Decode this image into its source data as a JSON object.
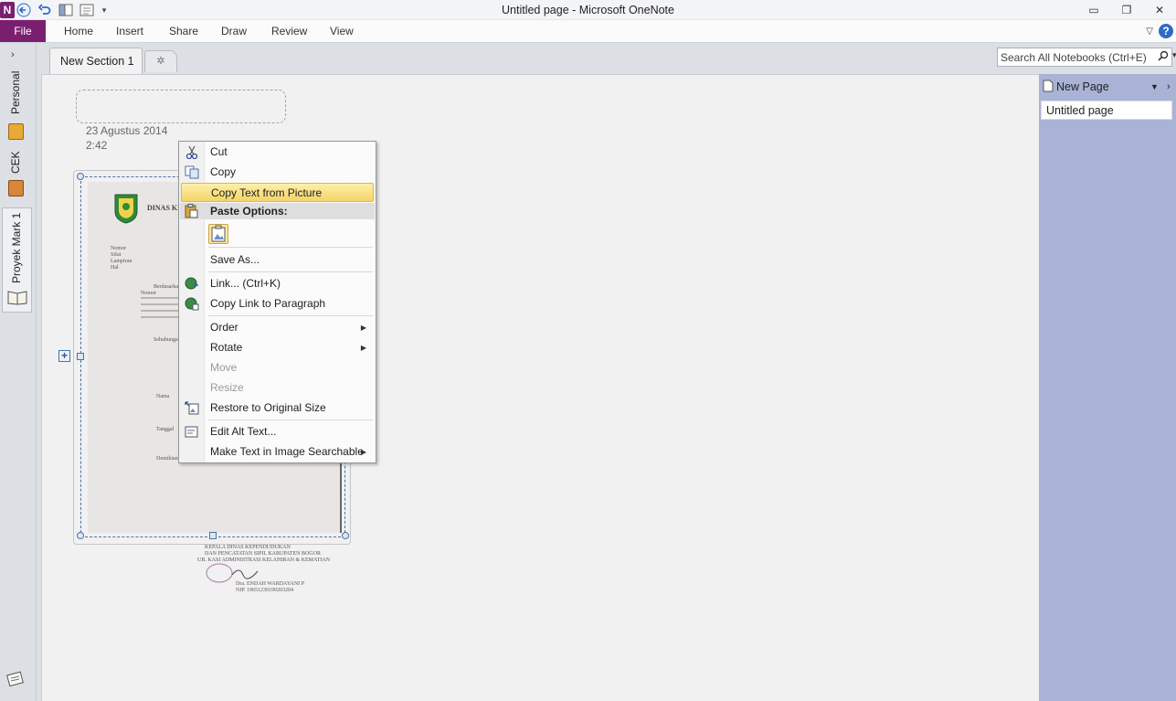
{
  "window": {
    "title": "Untitled page - Microsoft OneNote",
    "minimize": "▭",
    "restore": "❐",
    "close": "✕"
  },
  "ribbon": {
    "tabs": [
      "File",
      "Home",
      "Insert",
      "Share",
      "Draw",
      "Review",
      "View"
    ],
    "help": "?"
  },
  "notebooks": {
    "items": [
      {
        "label": "Personal",
        "color": "#e8a937"
      },
      {
        "label": "CEK",
        "color": "#d9853b"
      },
      {
        "label": "Proyek Mark 1",
        "color": "#8a7a5a"
      }
    ]
  },
  "sections": {
    "active": "New Section 1",
    "new_tab": "✲"
  },
  "search": {
    "placeholder": "Search All Notebooks (Ctrl+E)"
  },
  "page": {
    "date": "23 Agustus 2014",
    "time": "2:42"
  },
  "document_image": {
    "heading": "DINAS KE",
    "lines": [
      "Nomor",
      "Sifat",
      "Lampiran",
      "Hal",
      "Berdasarkan",
      "Nomor",
      "Sehubungan",
      "Nama",
      "Tanggal",
      "Demikian"
    ],
    "footer": [
      "KEPALA DINAS KEPENDUDUKAN",
      "DAN PENCATATAN SIPIL KABUPATEN BOGOR",
      "UB. KASI ADMINISTRASI KELAHIRAN & KEMATIAN",
      "Dra. ENDAH WARDAYANI P",
      "NIP. 19651230199203204"
    ]
  },
  "pages_pane": {
    "new_page": "New Page",
    "pages": [
      "Untitled page"
    ]
  },
  "context_menu": {
    "cut": "Cut",
    "copy": "Copy",
    "copy_text": "Copy Text from Picture",
    "paste_header": "Paste Options:",
    "save_as": "Save As...",
    "link": "Link...   (Ctrl+K)",
    "copy_link": "Copy Link to Paragraph",
    "order": "Order",
    "rotate": "Rotate",
    "move": "Move",
    "resize": "Resize",
    "restore": "Restore to Original Size",
    "alt_text": "Edit Alt Text...",
    "searchable": "Make Text in Image Searchable"
  },
  "colors": {
    "file_tab": "#7a1f6f",
    "highlight": "#f5d46a",
    "page_pane": "#a9b3d6"
  }
}
